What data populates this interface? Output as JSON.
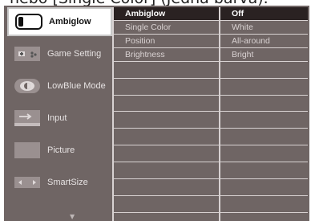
{
  "caption": "nebo [Single Color] (Jedna barva).",
  "main_menu": {
    "items": [
      {
        "label": "Ambiglow",
        "icon": "ambiglow-icon",
        "selected": true
      },
      {
        "label": "Game Setting",
        "icon": "gamepad-icon"
      },
      {
        "label": "LowBlue Mode",
        "icon": "eye-icon"
      },
      {
        "label": "Input",
        "icon": "input-icon"
      },
      {
        "label": "Picture",
        "icon": "picture-icon"
      },
      {
        "label": "SmartSize",
        "icon": "smartsize-icon"
      }
    ],
    "more_indicator": "▼"
  },
  "submenu": {
    "items": [
      "Ambiglow",
      "Single Color",
      "Position",
      "Brightness"
    ]
  },
  "options": {
    "items": [
      "Off",
      "White",
      "All-around",
      "Bright"
    ]
  },
  "colors": {
    "osd_background": "#6f6564",
    "highlight": "#2a2222",
    "separator": "#d8d2d2",
    "selected_tile": "#ffffff"
  }
}
